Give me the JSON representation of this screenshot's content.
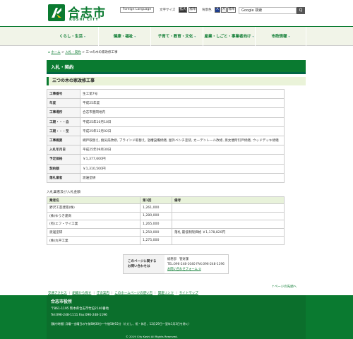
{
  "header": {
    "logo_text": "合志市",
    "logo_sub": "KOSHI CITY",
    "foreign_language": "Foreign Language",
    "font_size_label": "文字サイズ",
    "font_enlarge": "拡大",
    "font_standard": "標準",
    "bg_color_label": "背景色",
    "bg_a1": "A",
    "bg_a2": "A",
    "bg_standard": "標準",
    "search_placeholder": "Google 検索",
    "search_button": "Q"
  },
  "global_nav": [
    {
      "label": "くらし・生活"
    },
    {
      "label": "健康・福祉"
    },
    {
      "label": "子育て・教育・文化"
    },
    {
      "label": "産業・しごと・事業者向け"
    },
    {
      "label": "市政情報"
    }
  ],
  "breadcrumb": {
    "home": "ホーム",
    "level1": "入札・契約",
    "current": "三つの木の家改修工事"
  },
  "section_title": "入札・契約",
  "page_title": "三つの木の家改修工事",
  "details": [
    {
      "label": "工事番号",
      "value": "生工第7号"
    },
    {
      "label": "年度",
      "value": "平成25年度"
    },
    {
      "label": "工事場所",
      "value": "合志市豊岡地内"
    },
    {
      "label": "工期・・・自",
      "value": "平成25年10月10日"
    },
    {
      "label": "工期・・・至",
      "value": "平成25年12月02日"
    },
    {
      "label": "工事概要",
      "value": "網戸取替え, 換気扇改修, ブラインド取替え, 浴槽設備修繕, 屋外ベンチ塗装, カーテンレール改修, 男女便所引戸修繕, ウッドデッキ修繕"
    },
    {
      "label": "入札年月日",
      "value": "平成25年09月30日"
    },
    {
      "label": "予定価格",
      "value": "￥1,377,600円"
    },
    {
      "label": "契約額",
      "value": "￥1,310,500円"
    },
    {
      "label": "落札業者",
      "value": "渡邊塗研"
    }
  ],
  "bids": {
    "caption": "入札業者及び入札金額",
    "headers": [
      "業者名",
      "第1回",
      "備考"
    ],
    "rows": [
      [
        "野沢工芸建築(株)",
        "1,261,000",
        ""
      ],
      [
        "(株)ゆうき建商",
        "1,280,000",
        ""
      ],
      [
        "(有)エフ・サイ工業",
        "1,265,000",
        ""
      ],
      [
        "渡邊塗研",
        "1,250,000",
        "落札 最低制限価格 ￥1,178,820円"
      ],
      [
        "(株)丸平工業",
        "1,275,000",
        ""
      ]
    ]
  },
  "contact": {
    "label_line1": "このページに関する",
    "label_line2": "お問い合わせは",
    "dept": "総務部　管財課",
    "phone": "TEL:096-248-1040  FAX:096-248-1196",
    "form_link": "お問い合わせフォーム ⊙"
  },
  "to_top": "↑ページの先頭へ",
  "footer_nav": [
    "交通アクセス",
    "組織から探す",
    "庁舎案内",
    "このホームページの使い方",
    "関連リンク",
    "サイトマップ"
  ],
  "footer": {
    "name": "合志市役所",
    "address": "〒861-1195  熊本県合志市竹迫2140番地",
    "tel": "Tel:096-248-1111   Fax:096-248-1196",
    "hours": "[開庁時間] 月曜～金曜日の午前8時30分～午後5時15分（ただし、祝・休日、12月29日～翌年1月3日を除く）",
    "copyright": "© 2019 City Koshi All Rights Reserved."
  }
}
